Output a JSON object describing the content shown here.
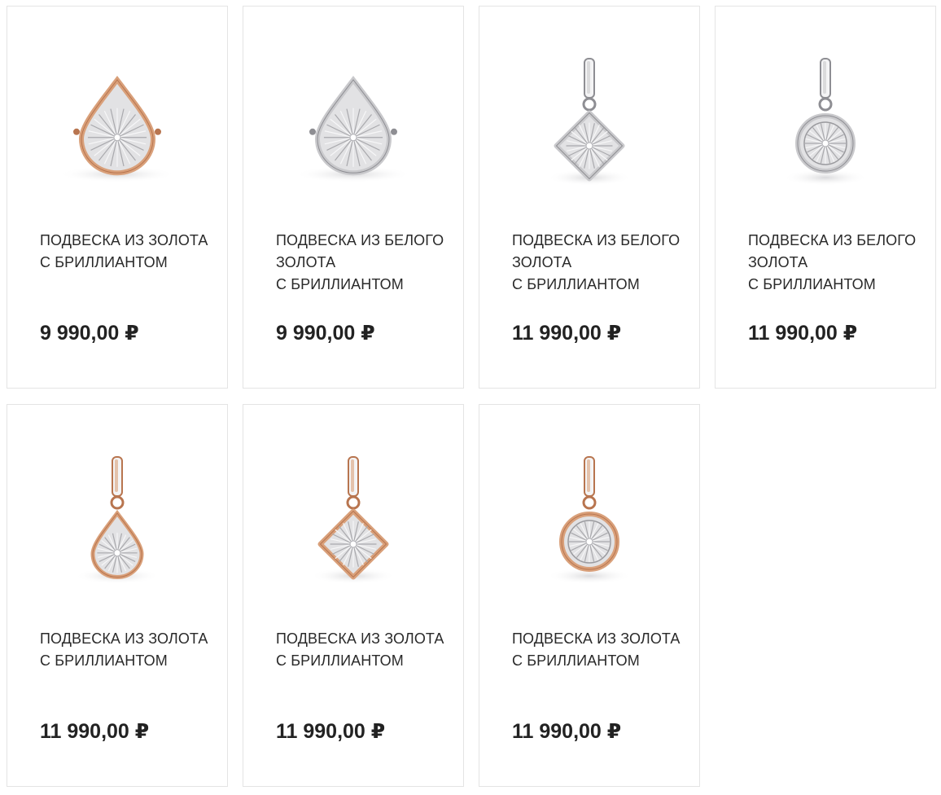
{
  "products": [
    {
      "title": "ПОДВЕСКА ИЗ ЗОЛОТА\nС БРИЛЛИАНТОМ",
      "price": "9 990,00 ₽",
      "icon": "gold-teardrop-pendant-icon",
      "metal": "rose-gold",
      "shape": "teardrop",
      "bail": false
    },
    {
      "title": "ПОДВЕСКА ИЗ БЕЛОГО\nЗОЛОТА\nС БРИЛЛИАНТОМ",
      "price": "9 990,00 ₽",
      "icon": "white-gold-teardrop-pendant-icon",
      "metal": "white-gold",
      "shape": "teardrop",
      "bail": false
    },
    {
      "title": "ПОДВЕСКА ИЗ БЕЛОГО\nЗОЛОТА\nС БРИЛЛИАНТОМ",
      "price": "11 990,00 ₽",
      "icon": "white-gold-square-pendant-icon",
      "metal": "white-gold",
      "shape": "square",
      "bail": true
    },
    {
      "title": "ПОДВЕСКА ИЗ БЕЛОГО\nЗОЛОТА\nС БРИЛЛИАНТОМ",
      "price": "11 990,00 ₽",
      "icon": "white-gold-round-pendant-icon",
      "metal": "white-gold",
      "shape": "round",
      "bail": true
    },
    {
      "title": "ПОДВЕСКА ИЗ ЗОЛОТА\nС БРИЛЛИАНТОМ",
      "price": "11 990,00 ₽",
      "icon": "gold-teardrop-pendant-icon",
      "metal": "rose-gold",
      "shape": "teardrop",
      "bail": true
    },
    {
      "title": "ПОДВЕСКА ИЗ ЗОЛОТА\nС БРИЛЛИАНТОМ",
      "price": "11 990,00 ₽",
      "icon": "gold-square-pendant-icon",
      "metal": "rose-gold",
      "shape": "square",
      "bail": true
    },
    {
      "title": "ПОДВЕСКА ИЗ ЗОЛОТА\nС БРИЛЛИАНТОМ",
      "price": "11 990,00 ₽",
      "icon": "gold-round-pendant-icon",
      "metal": "rose-gold",
      "shape": "round",
      "bail": true
    }
  ],
  "colors": {
    "rose-gold": "#d9a07a",
    "rose-gold-dark": "#b8754f",
    "white-gold": "#c9c9cc",
    "white-gold-dark": "#8e8e93",
    "inner": "#e2e2e4",
    "border": "#e4e4e4"
  }
}
